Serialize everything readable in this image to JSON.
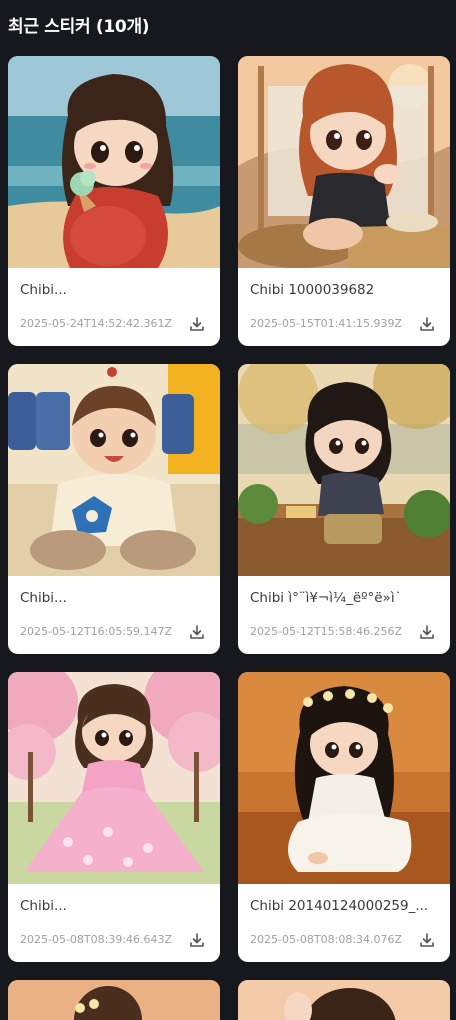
{
  "page": {
    "title": "최근 스티커 (10개)"
  },
  "stickers": [
    {
      "title": "Chibi...",
      "timestamp": "2025-05-24T14:52:42.361Z",
      "download_icon": "download-icon",
      "scene": "beach-icecream"
    },
    {
      "title": "Chibi 1000039682",
      "timestamp": "2025-05-15T01:41:15.939Z",
      "download_icon": "download-icon",
      "scene": "red-hair-sitting"
    },
    {
      "title": "Chibi...",
      "timestamp": "2025-05-12T16:05:59.147Z",
      "download_icon": "download-icon",
      "scene": "baby-toy"
    },
    {
      "title": "Chibi ì°¨ì¥¬ì¼_ëº°ë»ì˙",
      "timestamp": "2025-05-12T15:58:46.256Z",
      "download_icon": "download-icon",
      "scene": "girl-bench-park"
    },
    {
      "title": "Chibi...",
      "timestamp": "2025-05-08T08:39:46.643Z",
      "download_icon": "download-icon",
      "scene": "pink-dress-blossoms"
    },
    {
      "title": "Chibi 20140124000259_...",
      "timestamp": "2025-05-08T08:08:34.076Z",
      "download_icon": "download-icon",
      "scene": "white-dress-flowercrown"
    }
  ],
  "colors": {
    "background": "#16181d",
    "card": "#ffffff",
    "title_text": "#3a3a3a",
    "time_text": "#a0a0a0"
  }
}
